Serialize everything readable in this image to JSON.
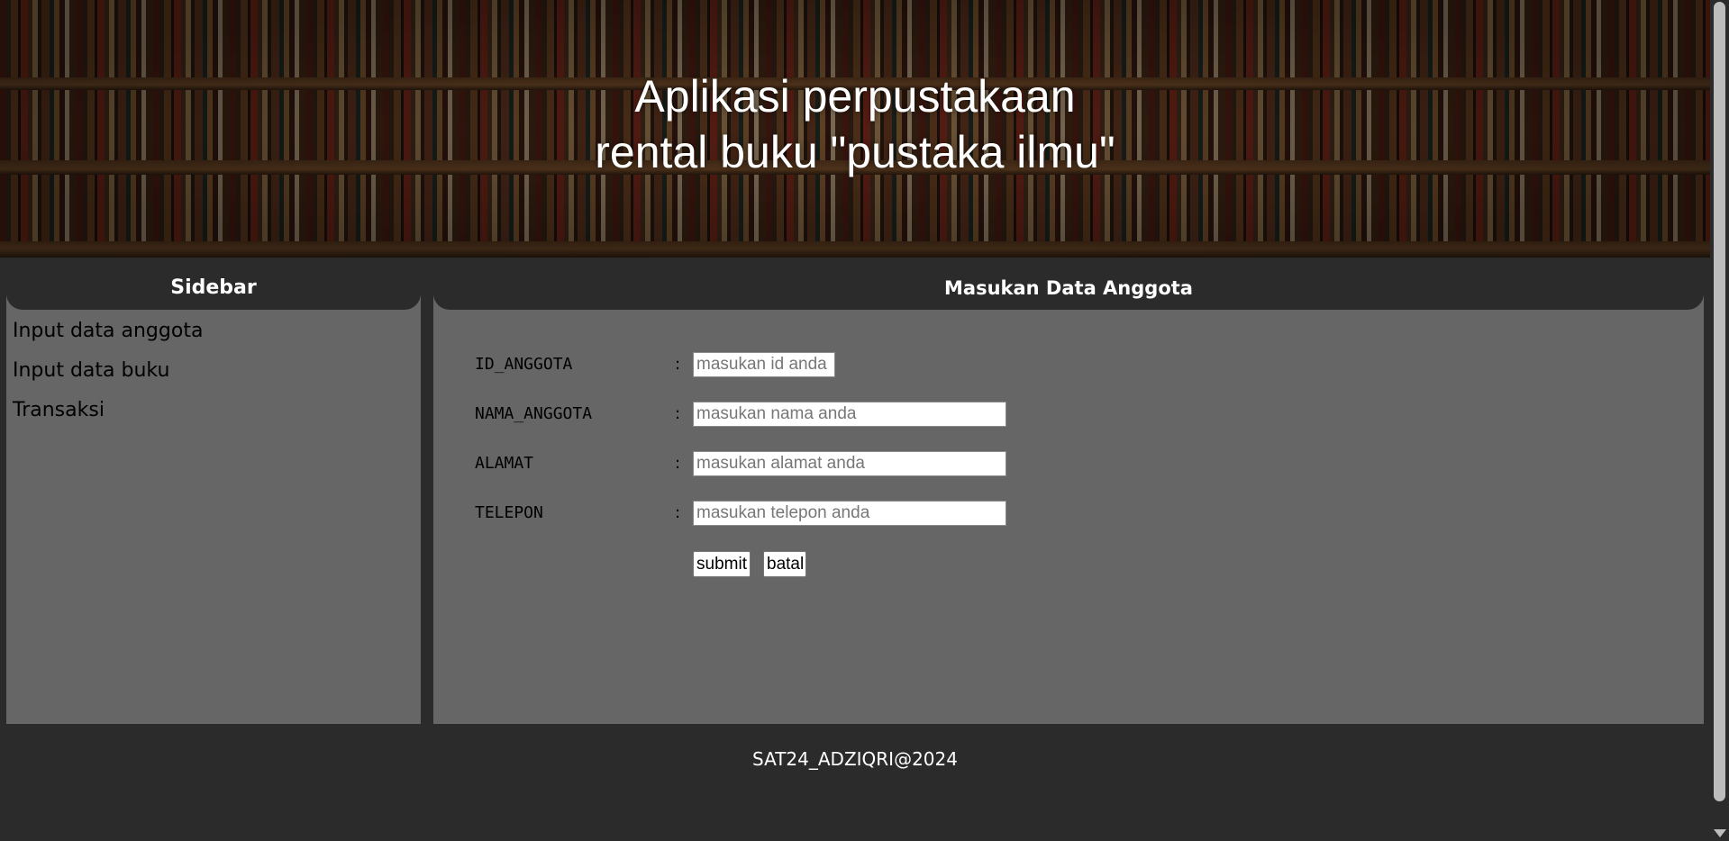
{
  "header": {
    "title_line1": "Aplikasi perpustakaan",
    "title_line2": "rental buku \"pustaka ilmu\""
  },
  "sidebar": {
    "title": "Sidebar",
    "items": [
      {
        "label": "Input data anggota"
      },
      {
        "label": "Input data buku"
      },
      {
        "label": "Transaksi"
      }
    ]
  },
  "main": {
    "title": "Masukan Data Anggota",
    "form": {
      "separator": ":",
      "fields": [
        {
          "label": "ID_ANGGOTA",
          "placeholder": "masukan id anda",
          "value": ""
        },
        {
          "label": "NAMA_ANGGOTA",
          "placeholder": "masukan nama anda",
          "value": ""
        },
        {
          "label": "ALAMAT",
          "placeholder": "masukan alamat anda",
          "value": ""
        },
        {
          "label": "TELEPON",
          "placeholder": "masukan telepon anda",
          "value": ""
        }
      ],
      "submit_label": "submit",
      "cancel_label": "batal"
    }
  },
  "footer": {
    "text": "SAT24_ADZIQRI@2024"
  },
  "colors": {
    "background": "#2b2b2b",
    "panel": "#666666",
    "text_light": "#ffffff",
    "text_dark": "#000000"
  }
}
